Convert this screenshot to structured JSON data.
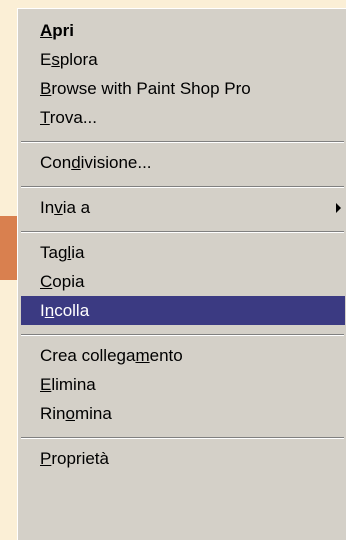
{
  "menu": {
    "items": [
      {
        "pre": "",
        "key": "A",
        "post": "pri",
        "bold": true
      },
      {
        "pre": "E",
        "key": "s",
        "post": "plora"
      },
      {
        "pre": "",
        "key": "B",
        "post": "rowse with Paint Shop Pro"
      },
      {
        "pre": "",
        "key": "T",
        "post": "rova..."
      },
      {
        "pre": "Con",
        "key": "d",
        "post": "ivisione..."
      },
      {
        "pre": "In",
        "key": "v",
        "post": "ia a",
        "submenu": true
      },
      {
        "pre": "Tag",
        "key": "l",
        "post": "ia"
      },
      {
        "pre": "",
        "key": "C",
        "post": "opia"
      },
      {
        "pre": "I",
        "key": "n",
        "post": "colla",
        "selected": true
      },
      {
        "pre": "Crea collega",
        "key": "m",
        "post": "ento"
      },
      {
        "pre": "",
        "key": "E",
        "post": "limina"
      },
      {
        "pre": "Rin",
        "key": "o",
        "post": "mina"
      },
      {
        "pre": "",
        "key": "P",
        "post": "roprietà"
      }
    ]
  },
  "colors": {
    "background": "#fbefd6",
    "menu_face": "#d4d0c8",
    "selection": "#3b3a82",
    "pointer_arrow": "#d9804f"
  }
}
